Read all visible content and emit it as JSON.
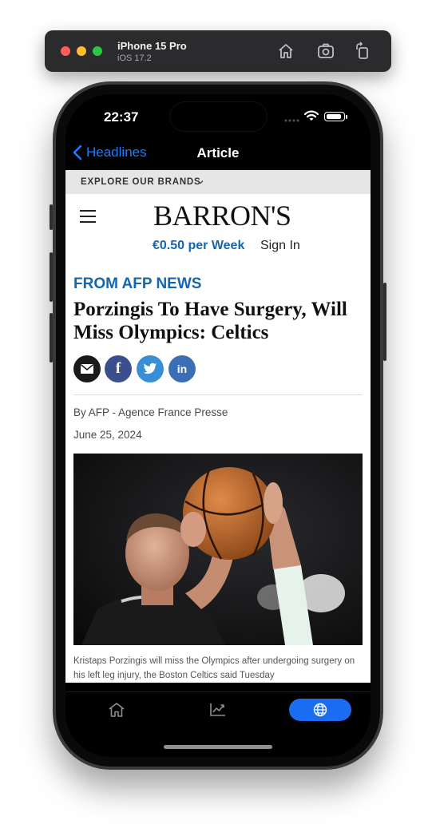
{
  "simulator": {
    "device": "iPhone 15 Pro",
    "os": "iOS 17.2",
    "icons": [
      "home-icon",
      "screenshot-icon",
      "rotate-icon"
    ]
  },
  "status_bar": {
    "time": "22:37"
  },
  "nav": {
    "back_label": "Headlines",
    "title": "Article"
  },
  "site": {
    "brands_label": "EXPLORE OUR BRANDS",
    "logo": "BARRON'S",
    "price": "€0.50 per Week",
    "sign_in": "Sign In"
  },
  "article": {
    "kicker": "FROM AFP NEWS",
    "headline": "Porzingis To Have Surgery, Will Miss Olympics: Celtics",
    "share": [
      "email-icon",
      "facebook-icon",
      "twitter-icon",
      "linkedin-icon"
    ],
    "share_glyphs": {
      "facebook": "f",
      "linkedin": "in"
    },
    "byline": "By AFP - Agence France Presse",
    "date": "June 25, 2024",
    "caption": "Kristaps Porzingis will miss the Olympics after undergoing surgery on his left leg injury, the Boston Celtics said Tuesday"
  },
  "tabbar": {
    "tabs": [
      "home-icon",
      "chart-icon",
      "globe-icon"
    ],
    "active": "globe-icon"
  },
  "colors": {
    "accent_blue": "#1466b3",
    "ios_blue": "#1a7cff",
    "tab_active": "#1a6df0",
    "facebook": "#3b5998",
    "twitter": "#3a8ed6",
    "linkedin": "#3a6fb5"
  }
}
